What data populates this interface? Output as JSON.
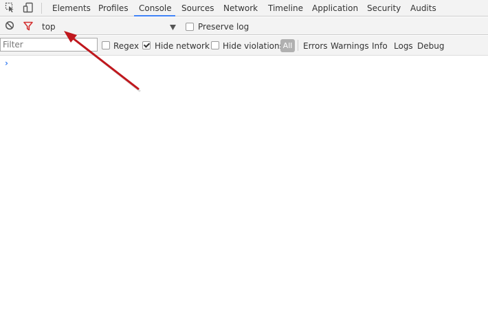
{
  "toolbar": {
    "inspect_icon": "inspect-element-icon",
    "device_icon": "device-toolbar-icon",
    "tabs": [
      "Elements",
      "Profiles",
      "Console",
      "Sources",
      "Network",
      "Timeline",
      "Application",
      "Security",
      "Audits"
    ],
    "active_tab": "Console"
  },
  "console_toolbar": {
    "clear_icon": "clear-console-icon",
    "filter_icon": "filter-icon",
    "context": "top",
    "preserve_log_label": "Preserve log",
    "preserve_log_checked": false
  },
  "filter_bar": {
    "filter_placeholder": "Filter",
    "filter_value": "",
    "regex_label": "Regex",
    "regex_checked": false,
    "hide_network_label": "Hide network",
    "hide_network_checked": true,
    "hide_violations_label": "Hide violations",
    "hide_violations_checked": false,
    "levels": [
      "All",
      "Errors",
      "Warnings",
      "Info",
      "Logs",
      "Debug"
    ],
    "active_level": "All"
  },
  "console": {
    "prompt_symbol": "›"
  },
  "annotation": {
    "arrow_color": "#c0171d"
  },
  "colors": {
    "accent": "#3e82f7",
    "filter_icon": "#d32f2f",
    "toolbar_bg": "#f3f3f3"
  }
}
